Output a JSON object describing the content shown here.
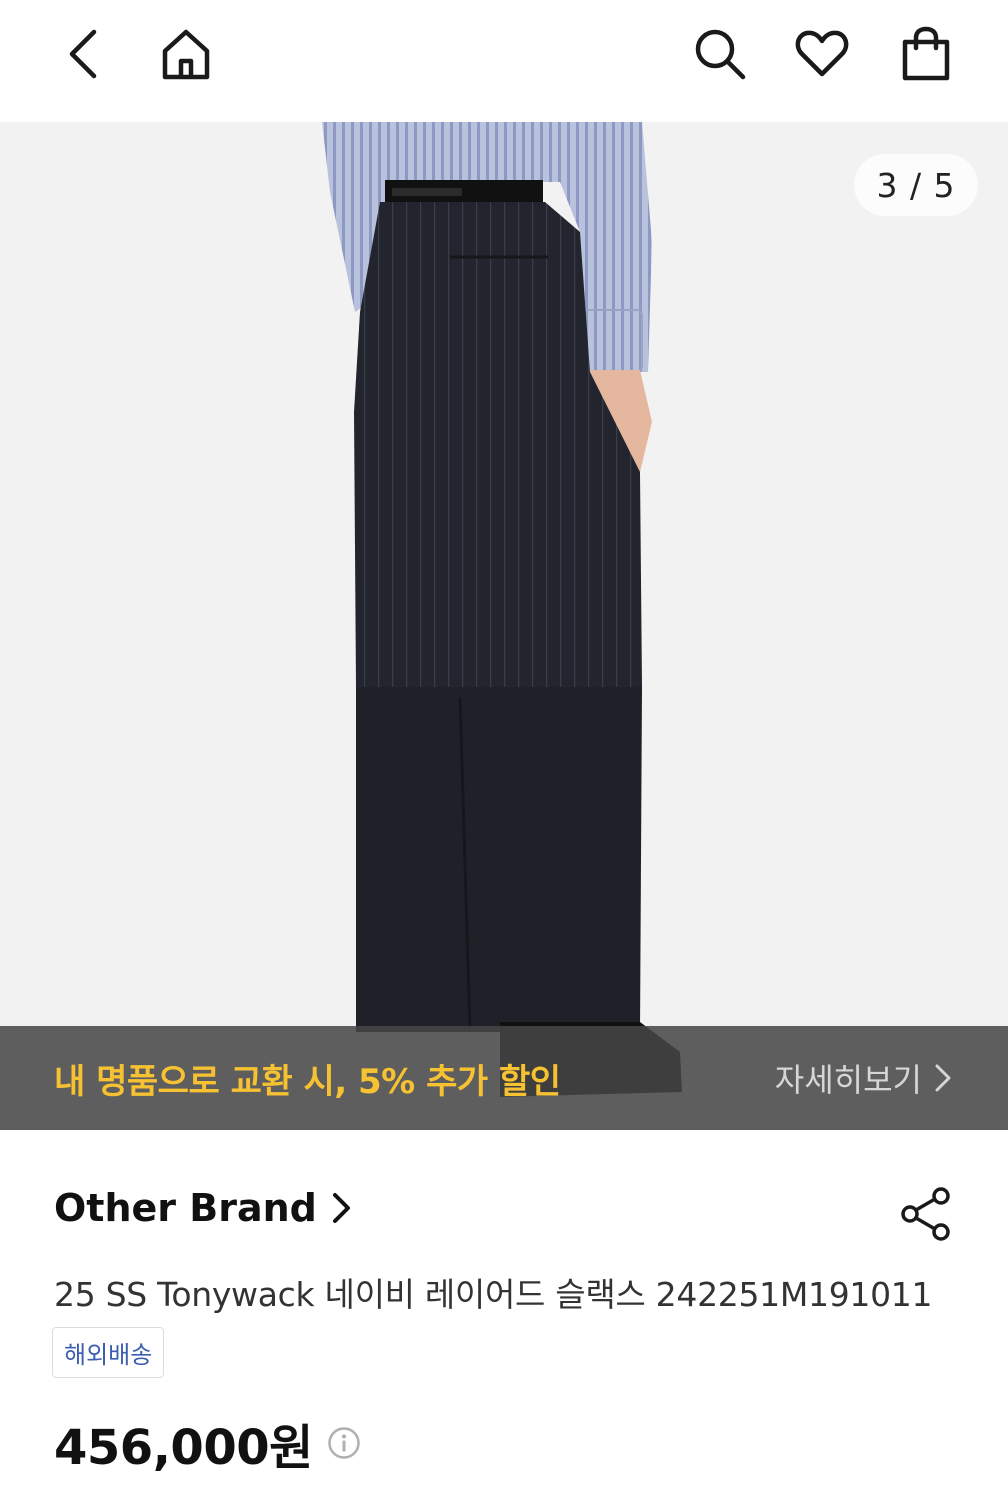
{
  "header": {
    "back_icon": "chevron-left-icon",
    "home_icon": "home-icon",
    "search_icon": "search-icon",
    "wishlist_icon": "heart-icon",
    "cart_icon": "shopping-bag-icon"
  },
  "gallery": {
    "counter": "3 / 5",
    "image_description_icon": "product-photo"
  },
  "promo": {
    "text": "내 명품으로 교환 시, 5% 추가 할인",
    "link": "자세히보기",
    "color": "#f7c232"
  },
  "product": {
    "brand": "Other Brand",
    "title": "25 SS Tonywack 네이비 레이어드 슬랙스 242251M191011",
    "tag": "해외배송",
    "price": "456,000원"
  }
}
